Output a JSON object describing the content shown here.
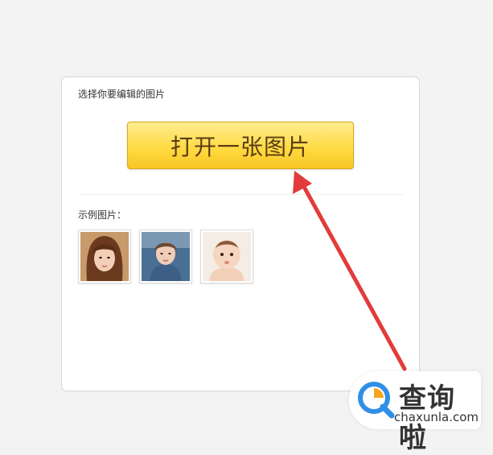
{
  "panel": {
    "title": "选择你要编辑的图片",
    "open_button_label": "打开一张图片",
    "examples_label": "示例图片："
  },
  "example_images": [
    {
      "name": "example-photo-woman-bangs"
    },
    {
      "name": "example-photo-woman-denim"
    },
    {
      "name": "example-photo-baby"
    }
  ],
  "watermark": {
    "title": "查询啦",
    "url": "chaxunla.com"
  },
  "colors": {
    "button_top": "#ffed8f",
    "button_bottom": "#f8c624",
    "button_text": "#5b3c12",
    "arrow": "#e23b3b",
    "logo_blue": "#2f8fe5",
    "logo_orange": "#f7a51c"
  }
}
